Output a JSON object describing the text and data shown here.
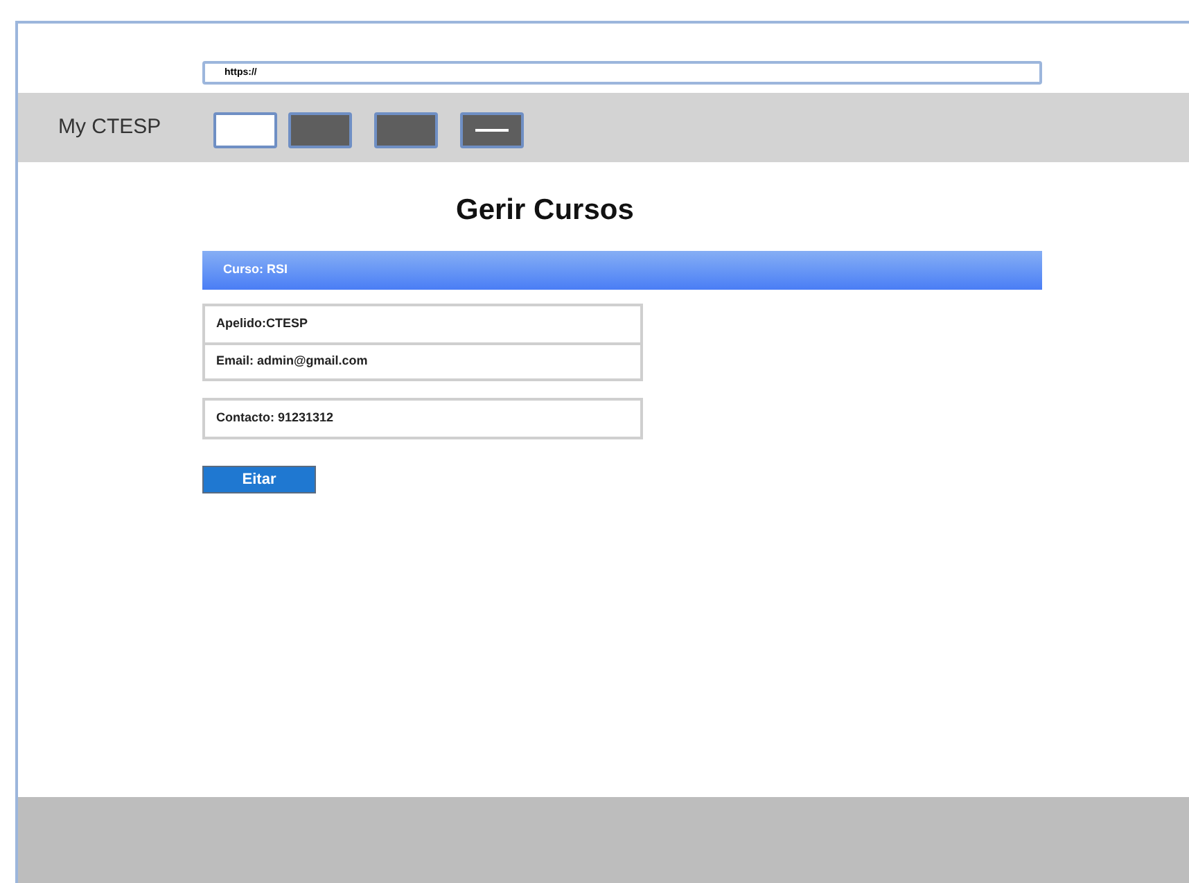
{
  "address_bar": {
    "value": "https://"
  },
  "brand": "My CTESP",
  "tabs": [
    {
      "kind": "blank",
      "selected": true
    },
    {
      "kind": "blank",
      "selected": false
    },
    {
      "kind": "blank",
      "selected": false
    },
    {
      "kind": "menu",
      "selected": false
    }
  ],
  "heading": "Gerir Cursos",
  "course_bar": "Curso: RSI",
  "details": [
    [
      "Apelido:CTESP",
      "Email: admin@gmail.com"
    ],
    [
      "Contacto: 91231312"
    ]
  ],
  "button": "Eitar"
}
